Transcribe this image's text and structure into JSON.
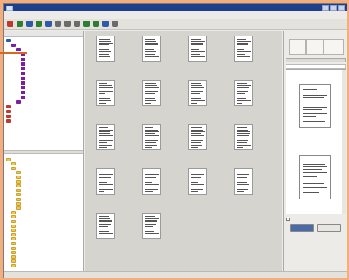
{
  "window": {
    "title": ""
  },
  "menubar": {
    "items": []
  },
  "toolbar": {
    "buttons": [
      "back-icon",
      "forward-icon",
      "scan-icon",
      "import-icon",
      "refresh-icon",
      "open-icon",
      "print-icon",
      "search-icon",
      "zoom-icon",
      "tool-icon",
      "settings-icon",
      "export-icon"
    ],
    "colors": [
      "#c0392b",
      "#2e7d32",
      "#2f5aa8",
      "#2e7d32",
      "#2f5aa8",
      "#6b6b6b",
      "#6b6b6b",
      "#6b6b6b",
      "#2e7d32",
      "#2e7d32",
      "#2f5aa8",
      "#6b6b6b"
    ]
  },
  "tree_top": {
    "header": "",
    "nodes": [
      {
        "label": "",
        "level": 0,
        "color": "#2f5aa8",
        "icon": "cabinet-icon"
      },
      {
        "label": "",
        "level": 1,
        "color": "#7b1fa2",
        "icon": "archive-icon"
      },
      {
        "label": "",
        "level": 2,
        "color": "#7b1fa2",
        "icon": "archive-icon"
      },
      {
        "label": "",
        "level": 3,
        "color": "#7b1fa2",
        "icon": "archive-icon"
      },
      {
        "label": "",
        "level": 3,
        "color": "#7b1fa2",
        "icon": "archive-icon"
      },
      {
        "label": "",
        "level": 3,
        "color": "#7b1fa2",
        "icon": "archive-icon"
      },
      {
        "label": "",
        "level": 3,
        "color": "#7b1fa2",
        "icon": "archive-icon"
      },
      {
        "label": "",
        "level": 3,
        "color": "#7b1fa2",
        "icon": "archive-icon"
      },
      {
        "label": "",
        "level": 3,
        "color": "#7b1fa2",
        "icon": "archive-icon"
      },
      {
        "label": "",
        "level": 3,
        "color": "#7b1fa2",
        "icon": "archive-icon"
      },
      {
        "label": "",
        "level": 3,
        "color": "#7b1fa2",
        "icon": "archive-icon"
      },
      {
        "label": "",
        "level": 3,
        "color": "#7b1fa2",
        "icon": "archive-icon"
      },
      {
        "label": "",
        "level": 3,
        "color": "#7b1fa2",
        "icon": "archive-icon"
      },
      {
        "label": "",
        "level": 2,
        "color": "#7b1fa2",
        "icon": "archive-icon"
      },
      {
        "label": "",
        "level": 0,
        "color": "#c0392b",
        "icon": "folder-icon"
      },
      {
        "label": "",
        "level": 0,
        "color": "#c0392b",
        "icon": "folder-icon"
      },
      {
        "label": "",
        "level": 0,
        "color": "#c0392b",
        "icon": "folder-icon"
      },
      {
        "label": "",
        "level": 0,
        "color": "#c0392b",
        "icon": "folder-icon"
      }
    ]
  },
  "tree_bottom": {
    "nodes": [
      {
        "label": "",
        "level": 0,
        "icon": "computer-icon"
      },
      {
        "label": "",
        "level": 1,
        "icon": "folder-icon"
      },
      {
        "label": "",
        "level": 1,
        "icon": "folder-icon"
      },
      {
        "label": "",
        "level": 2,
        "icon": "folder-icon"
      },
      {
        "label": "",
        "level": 2,
        "icon": "drive-icon"
      },
      {
        "label": "",
        "level": 2,
        "icon": "drive-icon"
      },
      {
        "label": "",
        "level": 2,
        "icon": "drive-icon"
      },
      {
        "label": "",
        "level": 2,
        "icon": "folder-icon"
      },
      {
        "label": "",
        "level": 2,
        "icon": "folder-icon"
      },
      {
        "label": "",
        "level": 2,
        "icon": "folder-icon"
      },
      {
        "label": "",
        "level": 2,
        "icon": "folder-icon"
      },
      {
        "label": "",
        "level": 2,
        "icon": "folder-icon"
      },
      {
        "label": "",
        "level": 1,
        "icon": "folder-icon"
      },
      {
        "label": "",
        "level": 1,
        "icon": "folder-icon"
      },
      {
        "label": "",
        "level": 1,
        "icon": "folder-icon"
      },
      {
        "label": "",
        "level": 1,
        "icon": "folder-icon"
      },
      {
        "label": "",
        "level": 1,
        "icon": "folder-icon"
      },
      {
        "label": "",
        "level": 1,
        "icon": "folder-icon"
      },
      {
        "label": "",
        "level": 1,
        "icon": "folder-icon"
      },
      {
        "label": "",
        "level": 1,
        "icon": "folder-icon"
      },
      {
        "label": "",
        "level": 1,
        "icon": "folder-icon"
      },
      {
        "label": "",
        "level": 1,
        "icon": "folder-icon"
      },
      {
        "label": "",
        "level": 1,
        "icon": "folder-icon"
      },
      {
        "label": "",
        "level": 1,
        "icon": "folder-icon"
      },
      {
        "label": "",
        "level": 1,
        "icon": "folder-icon"
      }
    ]
  },
  "documents": [
    {
      "caption": ""
    },
    {
      "caption": ""
    },
    {
      "caption": ""
    },
    {
      "caption": ""
    },
    {
      "caption": ""
    },
    {
      "caption": ""
    },
    {
      "caption": ""
    },
    {
      "caption": ""
    },
    {
      "caption": ""
    },
    {
      "caption": ""
    },
    {
      "caption": ""
    },
    {
      "caption": ""
    },
    {
      "caption": ""
    },
    {
      "caption": ""
    },
    {
      "caption": ""
    },
    {
      "caption": ""
    },
    {
      "caption": ""
    },
    {
      "caption": ""
    }
  ],
  "right_panel": {
    "tabs": [
      "",
      "",
      ""
    ],
    "header": "",
    "selected": "",
    "checkbox_label": "",
    "checkbox_right": "",
    "buttons": [
      "",
      ""
    ]
  },
  "status": {
    "text": ""
  }
}
